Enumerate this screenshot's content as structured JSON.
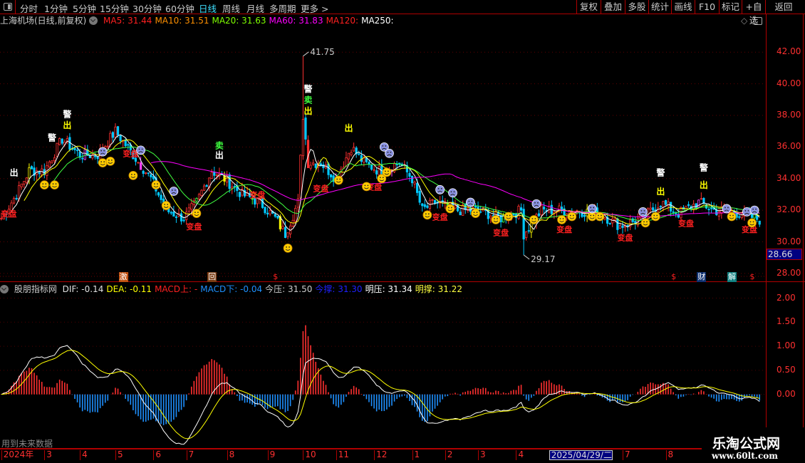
{
  "toolbar": {
    "periods": [
      "分时",
      "1分钟",
      "5分钟",
      "15分钟",
      "30分钟",
      "60分钟",
      "日线",
      "周线",
      "月线",
      "多周期",
      "更多 >"
    ],
    "active_period": "日线",
    "right_buttons": [
      "复权",
      "叠加",
      "多股",
      "统计",
      "画线",
      "F10",
      "标记",
      "+自选",
      "返回"
    ]
  },
  "title": {
    "stock": "上海机场(日线,前复权)",
    "ma": [
      {
        "label": "MA5: 31.44",
        "color": "#ff2020"
      },
      {
        "label": "MA10: 31.51",
        "color": "#ff9000"
      },
      {
        "label": "MA20: 31.63",
        "color": "#80ff00"
      },
      {
        "label": "MA60: 31.83",
        "color": "#ff00ff"
      },
      {
        "label": "MA120:",
        "color": "#ff2020"
      },
      {
        "label": "MA250:",
        "color": "#ffffff"
      }
    ]
  },
  "price_axis": {
    "ticks": [
      "42.00",
      "40.00",
      "38.00",
      "36.00",
      "34.00",
      "32.00",
      "30.00",
      "28.00"
    ],
    "current": "28.66"
  },
  "macd_header": {
    "name": "股朋指标网",
    "items": [
      {
        "label": "DIF: -0.14",
        "color": "#e0e0e0"
      },
      {
        "label": "DEA: -0.11",
        "color": "#ffff00"
      },
      {
        "label": "MACD上: -",
        "color": "#ff2020"
      },
      {
        "label": "MACD下: -0.04",
        "color": "#1e90ff"
      },
      {
        "label": "今压: 31.50",
        "color": "#cccccc"
      },
      {
        "label": "今撑: 31.30",
        "color": "#2020ff"
      },
      {
        "label": "明压: 31.34",
        "color": "#ffffff"
      },
      {
        "label": "明撑: 31.22",
        "color": "#ffff40"
      }
    ]
  },
  "macd_axis": {
    "ticks": [
      "2.00",
      "1.50",
      "1.00",
      "0.50",
      "0.00"
    ]
  },
  "future_note": "用到未来数据",
  "dates": [
    {
      "label": "2024年",
      "day": 0
    },
    {
      "label": "3",
      "day": 17
    },
    {
      "label": "4",
      "day": 31
    },
    {
      "label": "5",
      "day": 45
    },
    {
      "label": "6",
      "day": 60
    },
    {
      "label": "7",
      "day": 73
    },
    {
      "label": "8",
      "day": 89
    },
    {
      "label": "9",
      "day": 105
    },
    {
      "label": "10",
      "day": 119
    },
    {
      "label": "11",
      "day": 132
    },
    {
      "label": "12",
      "day": 147
    },
    {
      "label": "1",
      "day": 162
    },
    {
      "label": "2",
      "day": 175
    },
    {
      "label": "3",
      "day": 188
    },
    {
      "label": "4",
      "day": 203
    },
    {
      "label": "2025/04/29/二",
      "day": 216,
      "highlight": true
    },
    {
      "label": "7",
      "day": 245
    },
    {
      "label": "8",
      "day": 262
    }
  ],
  "signals": [
    {
      "text": "激",
      "day": 48,
      "bg": "#c05010"
    },
    {
      "text": "回",
      "day": 83,
      "bg": "#7a3a10"
    },
    {
      "text": "$",
      "day": 108,
      "bg": "transparent"
    },
    {
      "text": "$",
      "day": 265,
      "bg": "transparent"
    },
    {
      "text": "财",
      "day": 276,
      "bg": "#103070"
    },
    {
      "text": "解",
      "day": 288,
      "bg": "#108080"
    },
    {
      "text": "$",
      "day": 296,
      "bg": "transparent"
    }
  ],
  "watermark": {
    "title": "乐淘公式网",
    "url": "www.60lt.com"
  },
  "chart_data": {
    "type": "candlestick",
    "days": 300,
    "ylim": [
      27.5,
      43.5
    ],
    "macd_ylim": [
      -1.1,
      2.2
    ],
    "anchors": [
      [
        0,
        31.5
      ],
      [
        6,
        33
      ],
      [
        11,
        34.5
      ],
      [
        17,
        34.5
      ],
      [
        24,
        36.5
      ],
      [
        31,
        35.5
      ],
      [
        38,
        35.5
      ],
      [
        45,
        37
      ],
      [
        52,
        35.5
      ],
      [
        59,
        34
      ],
      [
        65,
        32
      ],
      [
        72,
        31.5
      ],
      [
        77,
        32.5
      ],
      [
        83,
        34.5
      ],
      [
        88,
        34
      ],
      [
        95,
        33
      ],
      [
        102,
        32.5
      ],
      [
        108,
        31.5
      ],
      [
        112,
        30.5
      ],
      [
        117,
        32.5
      ],
      [
        119,
        38
      ],
      [
        121,
        35
      ],
      [
        126,
        35
      ],
      [
        132,
        34
      ],
      [
        138,
        36
      ],
      [
        143,
        35
      ],
      [
        149,
        34.5
      ],
      [
        157,
        35
      ],
      [
        162,
        34
      ],
      [
        166,
        32
      ],
      [
        171,
        32.5
      ],
      [
        180,
        32
      ],
      [
        188,
        32
      ],
      [
        197,
        31.5
      ],
      [
        205,
        32
      ],
      [
        206,
        30.5
      ],
      [
        213,
        32
      ],
      [
        225,
        32
      ],
      [
        236,
        31.8
      ],
      [
        244,
        31
      ],
      [
        253,
        31.5
      ],
      [
        260,
        32.5
      ],
      [
        267,
        31.8
      ],
      [
        275,
        32.5
      ],
      [
        281,
        32
      ],
      [
        292,
        31.8
      ],
      [
        299,
        31.4
      ]
    ],
    "high_label": {
      "text": "41.75",
      "day": 119,
      "price": 41.75
    },
    "low_label": {
      "text": "29.17",
      "day": 206,
      "price": 29.17
    },
    "annotations": [
      {
        "text": "警",
        "day": 20,
        "price": 36.4,
        "color": "#ffffff"
      },
      {
        "text": "警",
        "day": 26,
        "price": 37.9,
        "color": "#ffffff"
      },
      {
        "text": "出",
        "day": 26,
        "price": 37.2,
        "color": "#ffff00"
      },
      {
        "text": "出",
        "day": 5,
        "price": 34.2,
        "color": "#ffffff"
      },
      {
        "text": "卖",
        "day": 86,
        "price": 35.9,
        "color": "#40ff40"
      },
      {
        "text": "出",
        "day": 86,
        "price": 35.3,
        "color": "#ffffff"
      },
      {
        "text": "警",
        "day": 121,
        "price": 39.5,
        "color": "#ffffff"
      },
      {
        "text": "卖",
        "day": 121,
        "price": 38.8,
        "color": "#40ff40"
      },
      {
        "text": "出",
        "day": 121,
        "price": 38.1,
        "color": "#ffff00"
      },
      {
        "text": "出",
        "day": 137,
        "price": 37.0,
        "color": "#ffff00"
      },
      {
        "text": "警",
        "day": 260,
        "price": 34.2,
        "color": "#ffffff"
      },
      {
        "text": "出",
        "day": 260,
        "price": 33.0,
        "color": "#ffff00"
      },
      {
        "text": "警",
        "day": 277,
        "price": 34.5,
        "color": "#ffffff"
      },
      {
        "text": "出",
        "day": 277,
        "price": 33.4,
        "color": "#ffff00"
      },
      {
        "text": "变盘",
        "day": 3,
        "price": 31.6,
        "color": "#ff2020"
      },
      {
        "text": "变盘",
        "day": 51,
        "price": 35.4,
        "color": "#ff2020"
      },
      {
        "text": "变盘",
        "day": 76,
        "price": 30.8,
        "color": "#ff2020"
      },
      {
        "text": "变盘",
        "day": 101,
        "price": 32.8,
        "color": "#ff2020"
      },
      {
        "text": "变盘",
        "day": 126,
        "price": 33.2,
        "color": "#ff2020"
      },
      {
        "text": "变盘",
        "day": 147,
        "price": 33.3,
        "color": "#ff2020"
      },
      {
        "text": "变盘",
        "day": 173,
        "price": 31.4,
        "color": "#ff2020"
      },
      {
        "text": "变盘",
        "day": 197,
        "price": 30.4,
        "color": "#ff2020"
      },
      {
        "text": "变盘",
        "day": 222,
        "price": 30.6,
        "color": "#ff2020"
      },
      {
        "text": "变盘",
        "day": 246,
        "price": 30.1,
        "color": "#ff2020"
      },
      {
        "text": "变盘",
        "day": 270,
        "price": 31.0,
        "color": "#ff2020"
      },
      {
        "text": "变盘",
        "day": 295,
        "price": 30.6,
        "color": "#ff2020"
      }
    ],
    "happy_faces": [
      [
        17,
        33.6
      ],
      [
        21,
        33.6
      ],
      [
        40,
        35.0
      ],
      [
        43,
        35.1
      ],
      [
        52,
        34.2
      ],
      [
        61,
        33.6
      ],
      [
        65,
        32.3
      ],
      [
        77,
        31.8
      ],
      [
        113,
        29.6
      ],
      [
        133,
        33.9
      ],
      [
        144,
        33.5
      ],
      [
        150,
        34.0
      ],
      [
        152,
        34.4
      ],
      [
        168,
        31.7
      ],
      [
        177,
        32.1
      ],
      [
        187,
        31.8
      ],
      [
        195,
        31.4
      ],
      [
        200,
        31.6
      ],
      [
        210,
        31.4
      ],
      [
        221,
        31.4
      ],
      [
        225,
        31.6
      ],
      [
        233,
        31.6
      ],
      [
        236,
        31.6
      ],
      [
        254,
        31.2
      ],
      [
        258,
        31.6
      ],
      [
        288,
        31.6
      ],
      [
        296,
        31.2
      ]
    ],
    "sad_faces": [
      [
        40,
        35.7
      ],
      [
        55,
        35.8
      ],
      [
        68,
        33.2
      ],
      [
        151,
        36.0
      ],
      [
        153,
        35.6
      ],
      [
        173,
        33.3
      ],
      [
        178,
        33.1
      ],
      [
        185,
        32.5
      ],
      [
        211,
        32.4
      ],
      [
        233,
        32.1
      ],
      [
        253,
        31.9
      ],
      [
        286,
        32.1
      ],
      [
        294,
        31.9
      ],
      [
        297,
        32.0
      ]
    ]
  }
}
